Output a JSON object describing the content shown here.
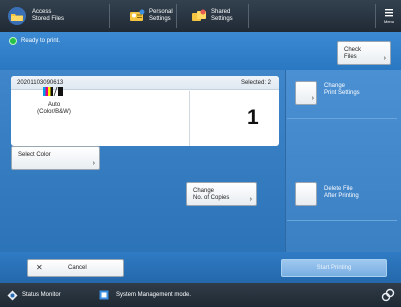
{
  "header": {
    "app_title": "Access\nStored Files",
    "personal_settings": "Personal\nSettings",
    "shared_settings": "Shared\nSettings",
    "menu": "Menu",
    "app_icon": "folder-icon",
    "personal_icon": "personal-settings-icon",
    "shared_icon": "shared-settings-icon",
    "menu_icon": "menu-icon"
  },
  "status": {
    "message": "Ready to print.",
    "indicator_color": "#27c14a",
    "check_files": "Check\nFiles"
  },
  "job": {
    "file_id": "20201103090613",
    "selected": "Selected: 2",
    "color_mode": "Auto\n(Color/B&W)",
    "copies": "1"
  },
  "buttons": {
    "select_color": "Select Color",
    "change_copies": "Change\nNo. of Copies",
    "cancel": "Cancel",
    "start_printing": "Start Printing"
  },
  "right_panel": {
    "change_print_settings": "Change\nPrint Settings",
    "delete_file": "Delete File\nAfter Printing"
  },
  "system_bar": {
    "status_monitor": "Status Monitor",
    "system_mode": "System Management mode."
  },
  "colors": {
    "header_bg": "#202a35",
    "main_blue": "#2c73b8",
    "accent_blue": "#3c80c4"
  }
}
